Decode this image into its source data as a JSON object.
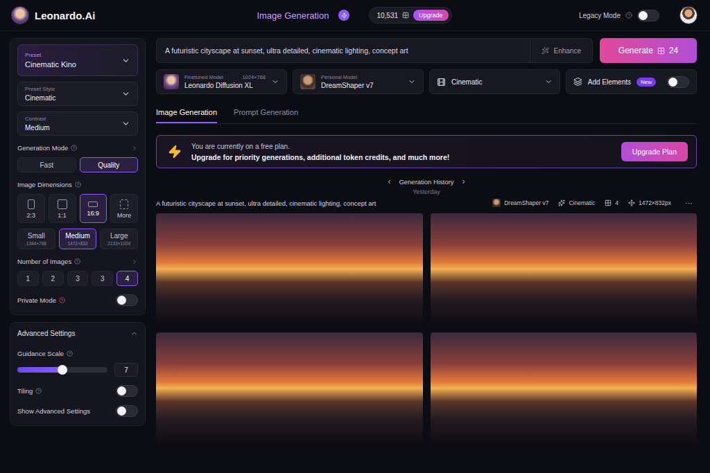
{
  "header": {
    "logo": "Leonardo.Ai",
    "title": "Image Generation",
    "tokens": "10,531",
    "upgrade": "Upgrade",
    "legacy": {
      "label": "Legacy Mode",
      "on": false
    }
  },
  "sidebar": {
    "preset": {
      "label": "Preset",
      "value": "Cinematic Kino"
    },
    "dropdowns": [
      {
        "label": "Preset Style",
        "value": "Cinematic"
      },
      {
        "label": "Contrast",
        "value": "Medium"
      }
    ],
    "generation_mode": {
      "label": "Generation Mode",
      "options": [
        {
          "label": "Fast",
          "selected": false
        },
        {
          "label": "Quality",
          "selected": true
        }
      ]
    },
    "dimensions": {
      "label": "Image Dimensions",
      "ratios": [
        {
          "label": "2:3",
          "selected": false
        },
        {
          "label": "1:1",
          "selected": false
        },
        {
          "label": "16:9",
          "selected": true
        },
        {
          "label": "More",
          "selected": false
        }
      ],
      "sizes": [
        {
          "label": "Small",
          "detail": "1344×768",
          "selected": false
        },
        {
          "label": "Medium",
          "detail": "1472×832",
          "selected": true
        },
        {
          "label": "Large",
          "detail": "2133×1024",
          "selected": false
        }
      ]
    },
    "number_of_images": {
      "label": "Number of Images",
      "options": [
        {
          "label": "1",
          "selected": false
        },
        {
          "label": "2",
          "selected": false
        },
        {
          "label": "3",
          "selected": false
        },
        {
          "label": "3",
          "selected": false
        },
        {
          "label": "4",
          "selected": true
        }
      ]
    },
    "private_mode": {
      "label": "Private Mode",
      "on": false
    },
    "advanced": {
      "title": "Advanced Settings",
      "expanded": true,
      "guidance": {
        "label": "Guidance Scale",
        "level": 0.5,
        "value": "7"
      },
      "toggles": [
        {
          "label": "Tiling",
          "on": false
        },
        {
          "label": "Show Advanced Settings",
          "on": false
        }
      ]
    }
  },
  "prompt": {
    "text": "A futuristic cityscape at sunset, ultra detailed, cinematic lighting, concept art",
    "enhance": "Enhance",
    "generate": "Generate",
    "cost": "24"
  },
  "selectors": [
    {
      "kind": "model",
      "label": "Finetuned Model",
      "value": "Leonardo Diffusion XL",
      "detail": "1024×768"
    },
    {
      "kind": "model",
      "label": "Personal Model",
      "value": "DreamShaper v7",
      "detail": ""
    },
    {
      "kind": "style",
      "label": "",
      "value": "Cinematic",
      "detail": ""
    }
  ],
  "elements": {
    "label": "Add Elements",
    "badge": "New",
    "on": false
  },
  "tabs": [
    {
      "label": "Image Generation",
      "selected": true
    },
    {
      "label": "Prompt Generation",
      "selected": false
    }
  ],
  "banner": {
    "title": "You are currently on a free plan.",
    "text": "Upgrade for priority generations, additional token credits, and much more!",
    "button": "Upgrade Plan"
  },
  "history": {
    "title": "Generation History",
    "prev": "‹",
    "next": "›",
    "day": "Yesterday",
    "prompt": "A futuristic cityscape at sunset, ultra detailed, cinematic lighting, concept art",
    "model": "DreamShaper v7",
    "style": "Cinematic",
    "count": "4",
    "size": "1472×832px",
    "more": "···",
    "images": [
      {
        "kind": "photo"
      },
      {
        "kind": "photo"
      },
      {
        "kind": "photo"
      },
      {
        "kind": "photo"
      }
    ]
  }
}
